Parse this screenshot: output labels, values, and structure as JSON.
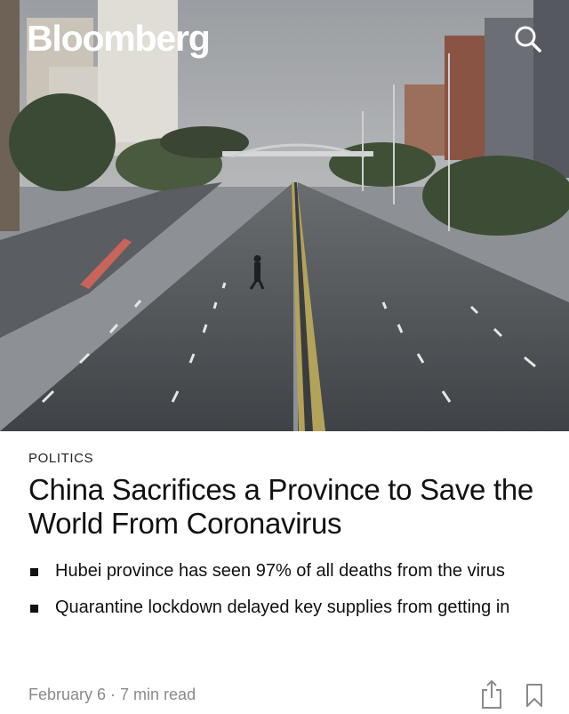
{
  "header": {
    "brand": "Bloomberg",
    "search_icon": "search-icon"
  },
  "hero": {
    "description_icon": "road-photo"
  },
  "article": {
    "category": "POLITICS",
    "headline": "China Sacrifices a Province to Save the World From Coronavirus",
    "bullets": [
      "Hubei province has seen 97% of all deaths from the virus",
      "Quarantine lockdown delayed key supplies from getting in"
    ],
    "meta": "February 6 · 7 min read"
  },
  "actions": {
    "share_icon": "share-icon",
    "bookmark_icon": "bookmark-icon"
  },
  "colors": {
    "text": "#111111",
    "meta": "#8a8a8a",
    "road": "#4a4d51"
  }
}
